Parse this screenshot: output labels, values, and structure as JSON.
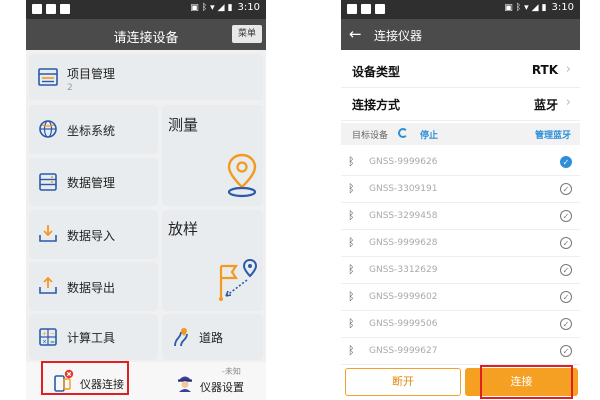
{
  "colors": {
    "accent_blue": "#2d8fd8",
    "accent_orange": "#f5a023",
    "header": "#4b4b4b",
    "highlight_red": "#e02020"
  },
  "left_screen": {
    "status_time": "3:10",
    "title": "请连接设备",
    "menu_label": "菜单",
    "cards": {
      "project": {
        "label": "项目管理",
        "count": "2",
        "icon": "folder-list-icon"
      },
      "coordinate": {
        "label": "坐标系统",
        "icon": "globe-icon"
      },
      "data_manage": {
        "label": "数据管理",
        "icon": "database-icon"
      },
      "data_import": {
        "label": "数据导入",
        "icon": "import-tray-icon"
      },
      "data_export": {
        "label": "数据导出",
        "icon": "export-tray-icon"
      },
      "calc_tools": {
        "label": "计算工具",
        "icon": "calculator-icon"
      },
      "survey": {
        "label": "测量",
        "icon": "map-pin-icon"
      },
      "stakeout": {
        "label": "放样",
        "icon": "flag-pin-icon"
      },
      "road": {
        "label": "道路",
        "icon": "road-icon"
      }
    },
    "bottom_nav": {
      "instrument_connect": {
        "label": "仪器连接",
        "icon": "instrument-connect-icon"
      },
      "instrument_settings": {
        "label": "仪器设置",
        "sub": "-未知",
        "icon": "instrument-avatar-icon"
      }
    }
  },
  "right_screen": {
    "status_time": "3:10",
    "title": "连接仪器",
    "device_type_label": "设备类型",
    "device_type_value": "RTK",
    "connect_mode_label": "连接方式",
    "connect_mode_value": "蓝牙",
    "target_label": "目标设备",
    "stop_label": "停止",
    "manage_bt_label": "管理蓝牙",
    "devices": [
      {
        "name": "GNSS-9999626",
        "selected": true
      },
      {
        "name": "GNSS-3309191",
        "selected": false
      },
      {
        "name": "GNSS-3299458",
        "selected": false
      },
      {
        "name": "GNSS-9999628",
        "selected": false
      },
      {
        "name": "GNSS-3312629",
        "selected": false
      },
      {
        "name": "GNSS-9999602",
        "selected": false
      },
      {
        "name": "GNSS-9999506",
        "selected": false
      },
      {
        "name": "GNSS-9999627",
        "selected": false
      }
    ],
    "disconnect_label": "断开",
    "connect_label": "连接"
  }
}
